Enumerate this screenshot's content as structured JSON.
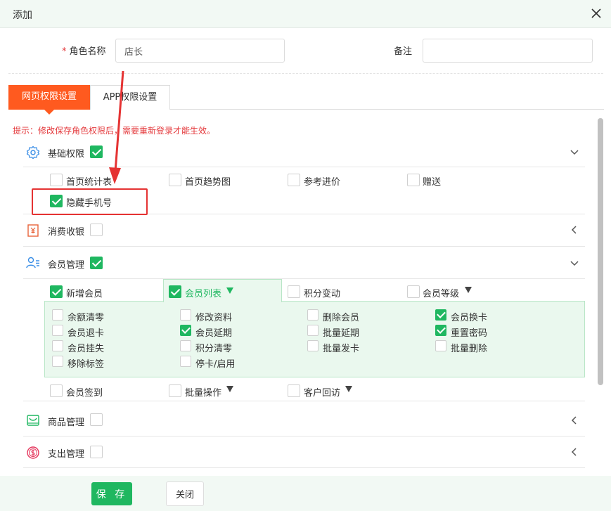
{
  "dialog": {
    "title": "添加"
  },
  "form": {
    "role_name_label": "角色名称",
    "role_name_required": "*",
    "role_name_value": "店长",
    "remark_label": "备注",
    "remark_value": ""
  },
  "tabs": [
    {
      "label": "网页权限设置",
      "active": true
    },
    {
      "label": "APP权限设置",
      "active": false
    }
  ],
  "tip": "提示：修改保存角色权限后，需要重新登录才能生效。",
  "sections": {
    "basic": {
      "title": "基础权限",
      "checked": true,
      "expanded": true,
      "icon": "gear-icon",
      "items": [
        {
          "label": "首页统计表",
          "checked": false
        },
        {
          "label": "首页趋势图",
          "checked": false
        },
        {
          "label": "参考进价",
          "checked": false
        },
        {
          "label": "赠送",
          "checked": false
        },
        {
          "label": "隐藏手机号",
          "checked": true
        }
      ]
    },
    "cashier": {
      "title": "消费收银",
      "checked": false,
      "expanded": false,
      "icon": "receipt-icon"
    },
    "member": {
      "title": "会员管理",
      "checked": true,
      "expanded": true,
      "icon": "member-icon",
      "subtabs": [
        {
          "label": "新增会员",
          "checked": true,
          "dropdown": false
        },
        {
          "label": "会员列表",
          "checked": true,
          "dropdown": true
        },
        {
          "label": "积分变动",
          "checked": false,
          "dropdown": false
        },
        {
          "label": "会员等级",
          "checked": false,
          "dropdown": true
        }
      ],
      "list_items": [
        {
          "label": "余额清零",
          "checked": false
        },
        {
          "label": "修改资料",
          "checked": false
        },
        {
          "label": "删除会员",
          "checked": false
        },
        {
          "label": "会员换卡",
          "checked": true
        },
        {
          "label": "会员退卡",
          "checked": false
        },
        {
          "label": "会员延期",
          "checked": true
        },
        {
          "label": "批量延期",
          "checked": false
        },
        {
          "label": "重置密码",
          "checked": true
        },
        {
          "label": "会员挂失",
          "checked": false
        },
        {
          "label": "积分清零",
          "checked": false
        },
        {
          "label": "批量发卡",
          "checked": false
        },
        {
          "label": "批量删除",
          "checked": false
        },
        {
          "label": "移除标签",
          "checked": false
        },
        {
          "label": "停卡/启用",
          "checked": false
        }
      ],
      "bottom_items": [
        {
          "label": "会员签到",
          "checked": false,
          "dropdown": false
        },
        {
          "label": "批量操作",
          "checked": false,
          "dropdown": true
        },
        {
          "label": "客户回访",
          "checked": false,
          "dropdown": true
        }
      ]
    },
    "goods": {
      "title": "商品管理",
      "checked": false,
      "expanded": false,
      "icon": "goods-icon"
    },
    "expense": {
      "title": "支出管理",
      "checked": false,
      "expanded": false,
      "icon": "coin-icon"
    }
  },
  "footer": {
    "save_label": "保 存",
    "close_label": "关闭"
  },
  "colors": {
    "accent_green": "#1fb760",
    "tab_orange": "#ff5a1f",
    "tip_red": "#e4393c",
    "annotation_red": "#e53333"
  }
}
